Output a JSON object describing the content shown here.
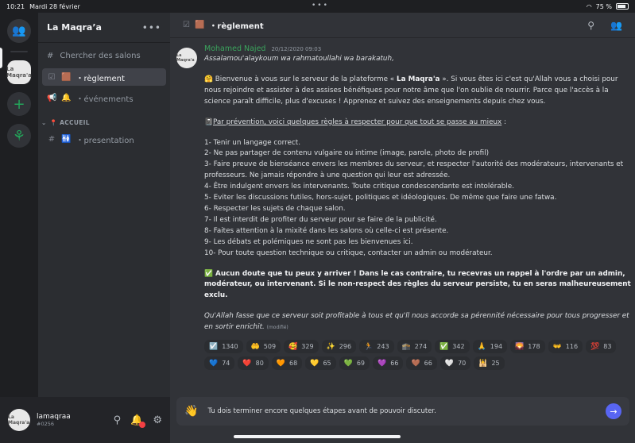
{
  "status": {
    "time": "10:21",
    "date": "Mardi 28 février",
    "dots": "•••",
    "battery": "75 %"
  },
  "servers": {
    "active_label": "La Maqra'a"
  },
  "sidebar": {
    "guild_name": "La Maqra’a",
    "search_label": "Chercher des salons",
    "channels": [
      {
        "emoji": "🟫",
        "label": "・règlement"
      },
      {
        "emoji": "🔔",
        "label": "・événements"
      }
    ],
    "category": "📍 ACCUEIL",
    "category_channels": [
      {
        "emoji": "🚻",
        "label": "・presentation"
      }
    ]
  },
  "user": {
    "name": "lamaqraa",
    "tag": "#0256",
    "avatar_label": "La Maqra'a"
  },
  "header": {
    "emoji": "🟫",
    "title": "・règlement"
  },
  "message": {
    "author": "Mohamed Najed",
    "timestamp": "20/12/2020 09:03",
    "greeting": "Assalamou'alaykoum wa rahmatoullahi wa barakatuh,",
    "intro_pre": "🤗 Bienvenue à vous sur le serveur de la plateforme « ",
    "intro_bold": "La Maqra'a",
    "intro_post": " ». Si vous êtes ici c'est qu'Allah vous a choisi pour nous rejoindre et assister à des assises bénéfiques pour notre âme que l'on oublie de nourrir. Parce que l'accès à la science paraît difficile, plus d'excuses ! Apprenez et suivez des enseignements depuis chez vous.",
    "rules_emoji": "📓",
    "rules_intro": "Par prévention, voici quelques règles à respecter pour que tout se passe au mieux",
    "rules_colon": " :",
    "rules": [
      "1-   Tenir un langage correct.",
      "2-   Ne pas partager de contenu vulgaire ou intime (image, parole, photo de profil)",
      "3-   Faire preuve de bienséance envers les membres du serveur, et respecter l'autorité des modérateurs, intervenants et professeurs. Ne jamais répondre à une question qui leur est adressée.",
      "4-   Être indulgent envers les intervenants. Toute critique condescendante est intolérable.",
      "5-   Eviter les discussions futiles, hors-sujet, politiques et idéologiques. De même que faire une fatwa.",
      "6-   Respecter les sujets de chaque salon.",
      "7-   Il est interdit de profiter du serveur pour se faire de la publicité.",
      "8-   Faites attention à la mixité dans les salons où celle-ci est présente.",
      "9-   Les débats et polémiques ne sont pas les bienvenues ici.",
      "10- Pour toute question technique ou critique, contacter un admin ou modérateur."
    ],
    "closing_bold": "✅ Aucun doute que tu peux y arriver ! Dans le cas contraire, tu recevras un rappel à l'ordre par un admin, modérateur, ou intervenant. Si le non-respect des règles du serveur persiste, tu en seras malheureusement exclu.",
    "dua": "Qu'Allah fasse que ce serveur soit profitable à tous et qu'll nous accorde sa pérennité nécessaire pour tous progresser et en sortir enrichit.",
    "edited": "(modifié)"
  },
  "reactions": [
    {
      "emoji": "☑️",
      "count": "1340"
    },
    {
      "emoji": "🤲",
      "count": "509"
    },
    {
      "emoji": "🥰",
      "count": "329"
    },
    {
      "emoji": "✨",
      "count": "296"
    },
    {
      "emoji": "🏃",
      "count": "243"
    },
    {
      "emoji": "🕋",
      "count": "274"
    },
    {
      "emoji": "✅",
      "count": "342"
    },
    {
      "emoji": "🙏",
      "count": "194"
    },
    {
      "emoji": "🌄",
      "count": "178"
    },
    {
      "emoji": "👐",
      "count": "116"
    },
    {
      "emoji": "💯",
      "count": "83"
    },
    {
      "emoji": "💙",
      "count": "74"
    },
    {
      "emoji": "❤️",
      "count": "80"
    },
    {
      "emoji": "🧡",
      "count": "68"
    },
    {
      "emoji": "💛",
      "count": "65"
    },
    {
      "emoji": "💚",
      "count": "69"
    },
    {
      "emoji": "💜",
      "count": "66"
    },
    {
      "emoji": "🤎",
      "count": "66"
    },
    {
      "emoji": "🤍",
      "count": "70"
    },
    {
      "emoji": "🕌",
      "count": "25"
    }
  ],
  "composer": {
    "emoji": "👋",
    "text": "Tu dois terminer encore quelques étapes avant de pouvoir discuter."
  }
}
